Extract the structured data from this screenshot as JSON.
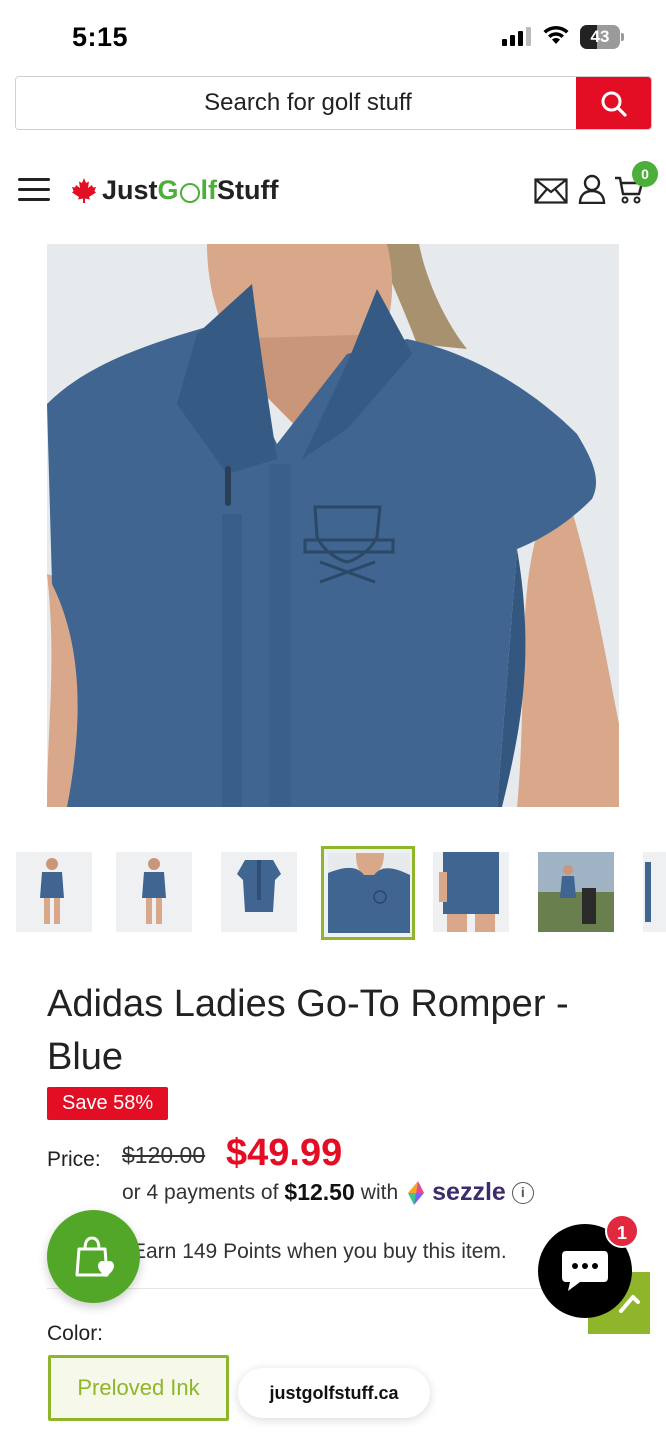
{
  "status_bar": {
    "time": "5:15",
    "battery": "43",
    "battery_level": 0.43
  },
  "search": {
    "placeholder": "Search for golf stuff"
  },
  "header": {
    "logo_parts": [
      "Just",
      "G",
      "lf",
      "Stuff"
    ],
    "cart_count": "0",
    "icons": [
      "menu-icon",
      "maple-leaf-icon",
      "mail-icon",
      "account-icon",
      "cart-icon"
    ]
  },
  "gallery": {
    "thumbnail_count": 7,
    "active_index": 3
  },
  "product": {
    "title": "Adidas Ladies Go-To Romper - Blue",
    "save_badge": "Save 58%",
    "price_label": "Price:",
    "old_price": "$120.00",
    "new_price": "$49.99",
    "installments_prefix": "or 4 payments of",
    "installment_amount": "$12.50",
    "installments_with": "with",
    "sezzle_name": "sezzle",
    "points_text": "Earn 149 Points when you buy this item.",
    "color_label": "Color:",
    "selected_color": "Preloved Ink"
  },
  "footer": {
    "domain": "justgolfstuff.ca"
  },
  "chat": {
    "badge": "1"
  },
  "colors": {
    "accent_red": "#e30e24",
    "brand_green": "#4caf3a",
    "lime": "#8fb62a",
    "product_blue": "#3f6590"
  }
}
